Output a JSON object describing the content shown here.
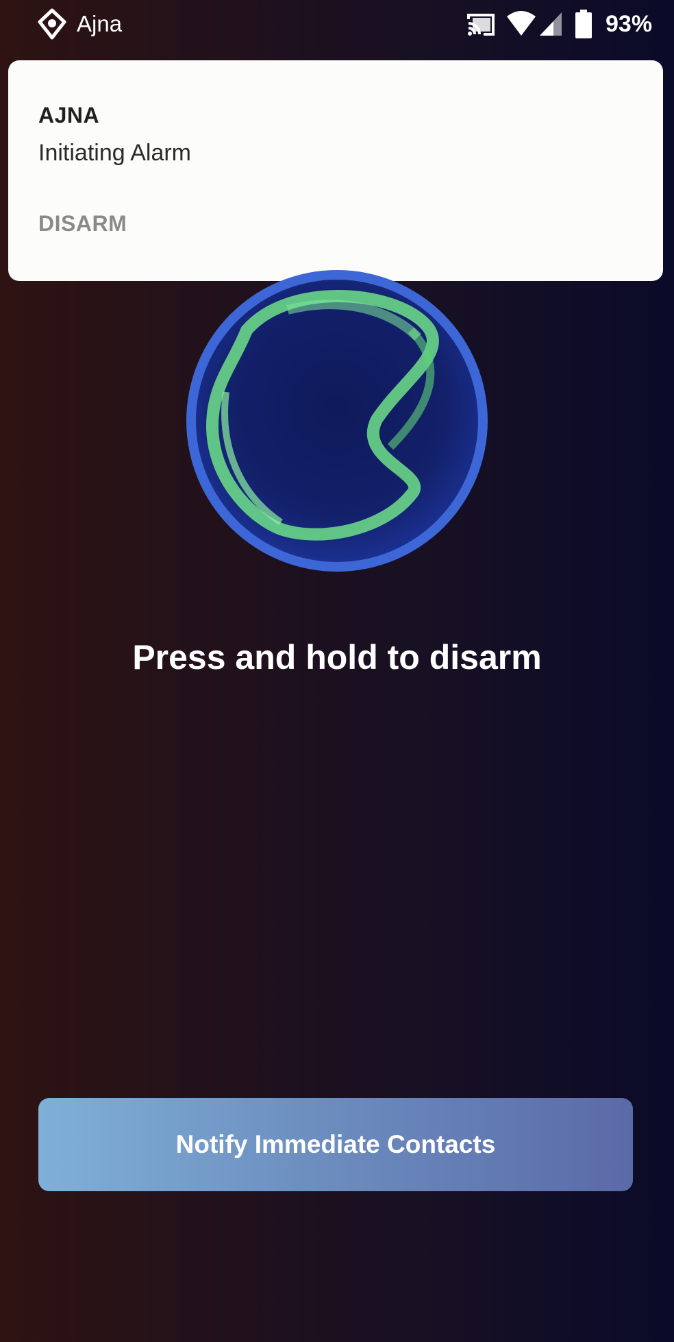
{
  "status_bar": {
    "app_name": "Ajna",
    "battery": "93%",
    "icons": [
      "ajna-app-icon",
      "cast-icon",
      "wifi-icon",
      "signal-icon",
      "battery-icon"
    ]
  },
  "notification": {
    "title": "AJNA",
    "text": "Initiating Alarm",
    "action": "DISARM"
  },
  "main": {
    "instruction": "Press and hold to disarm",
    "notify_button": "Notify Immediate Contacts"
  },
  "colors": {
    "orb_blue": "#3d66d6",
    "orb_green": "#6fe08a",
    "button_start": "#7fb0d8",
    "button_end": "#5a6aa8"
  }
}
